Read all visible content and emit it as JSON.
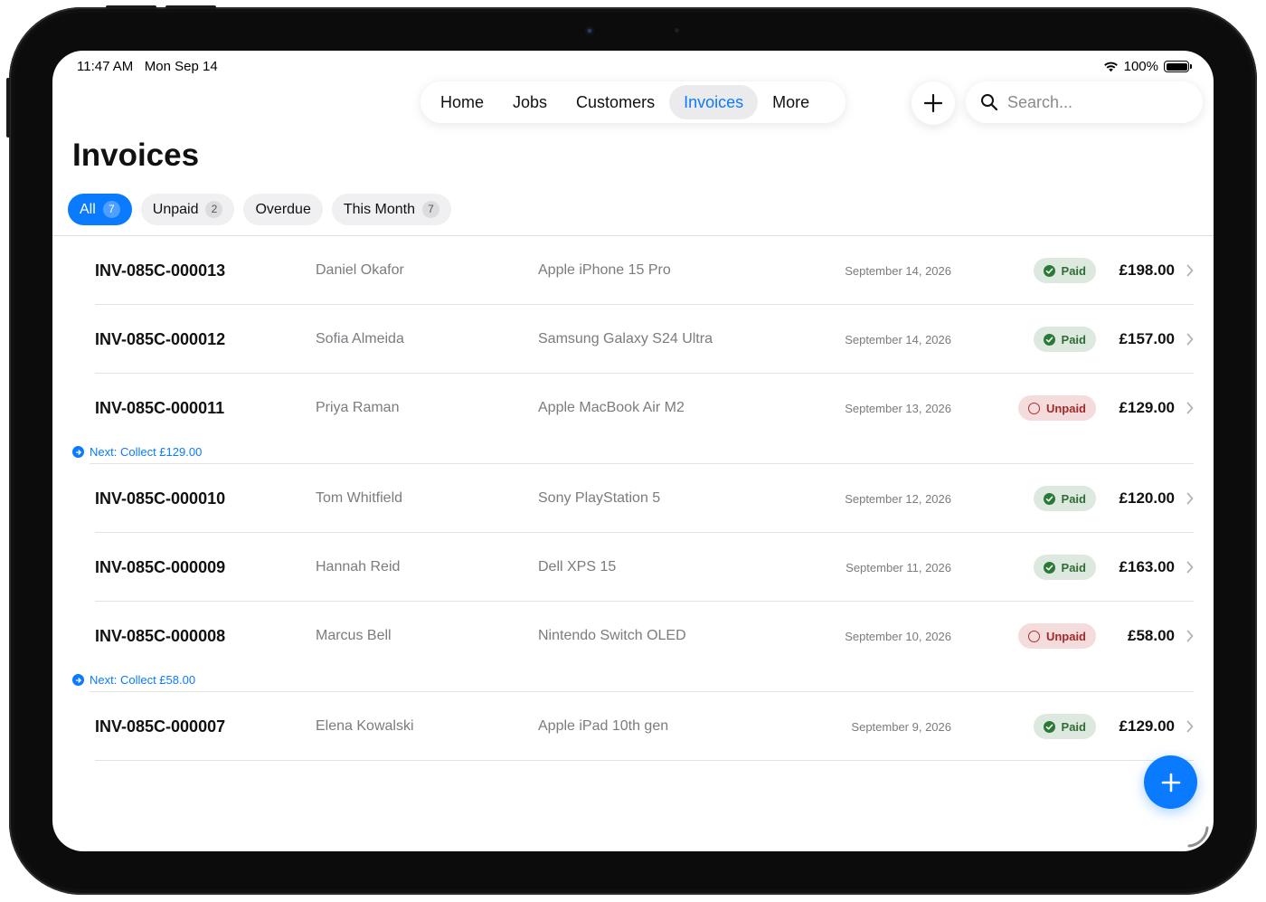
{
  "status_bar": {
    "time": "11:47 AM",
    "date": "Mon Sep 14",
    "battery": "100%"
  },
  "nav": {
    "tabs": [
      {
        "label": "Home"
      },
      {
        "label": "Jobs"
      },
      {
        "label": "Customers"
      },
      {
        "label": "Invoices",
        "active": true
      },
      {
        "label": "More"
      }
    ],
    "add_icon": "plus-icon",
    "search_placeholder": "Search..."
  },
  "page": {
    "title": "Invoices"
  },
  "filters": [
    {
      "label": "All",
      "count": "7",
      "active": true
    },
    {
      "label": "Unpaid",
      "count": "2"
    },
    {
      "label": "Overdue"
    },
    {
      "label": "This Month",
      "count": "7"
    }
  ],
  "invoices": [
    {
      "id": "INV-085C-000013",
      "customer": "Daniel Okafor",
      "device": "Apple iPhone 15 Pro",
      "date": "September 14, 2026",
      "status": "Paid",
      "amount": "£198.00"
    },
    {
      "id": "INV-085C-000012",
      "customer": "Sofia Almeida",
      "device": "Samsung Galaxy S24 Ultra",
      "date": "September 14, 2026",
      "status": "Paid",
      "amount": "£157.00"
    },
    {
      "id": "INV-085C-000011",
      "customer": "Priya Raman",
      "device": "Apple MacBook Air M2",
      "date": "September 13, 2026",
      "status": "Unpaid",
      "amount": "£129.00",
      "next": "Next: Collect £129.00"
    },
    {
      "id": "INV-085C-000010",
      "customer": "Tom Whitfield",
      "device": "Sony PlayStation 5",
      "date": "September 12, 2026",
      "status": "Paid",
      "amount": "£120.00"
    },
    {
      "id": "INV-085C-000009",
      "customer": "Hannah Reid",
      "device": "Dell XPS 15",
      "date": "September 11, 2026",
      "status": "Paid",
      "amount": "£163.00"
    },
    {
      "id": "INV-085C-000008",
      "customer": "Marcus Bell",
      "device": "Nintendo Switch OLED",
      "date": "September 10, 2026",
      "status": "Unpaid",
      "amount": "£58.00",
      "next": "Next: Collect £58.00"
    },
    {
      "id": "INV-085C-000007",
      "customer": "Elena Kowalski",
      "device": "Apple iPad 10th gen",
      "date": "September 9, 2026",
      "status": "Paid",
      "amount": "£129.00"
    }
  ],
  "colors": {
    "accent": "#0a7aff",
    "paid_bg": "#dde8de",
    "paid_fg": "#2f6d38",
    "unpaid_bg": "#f4dcdc",
    "unpaid_fg": "#a12a2a"
  },
  "icons": {
    "wifi": "wifi-icon",
    "battery": "battery-icon",
    "search": "search-icon",
    "chevron": "chevron-right-icon",
    "fab": "plus-icon"
  }
}
